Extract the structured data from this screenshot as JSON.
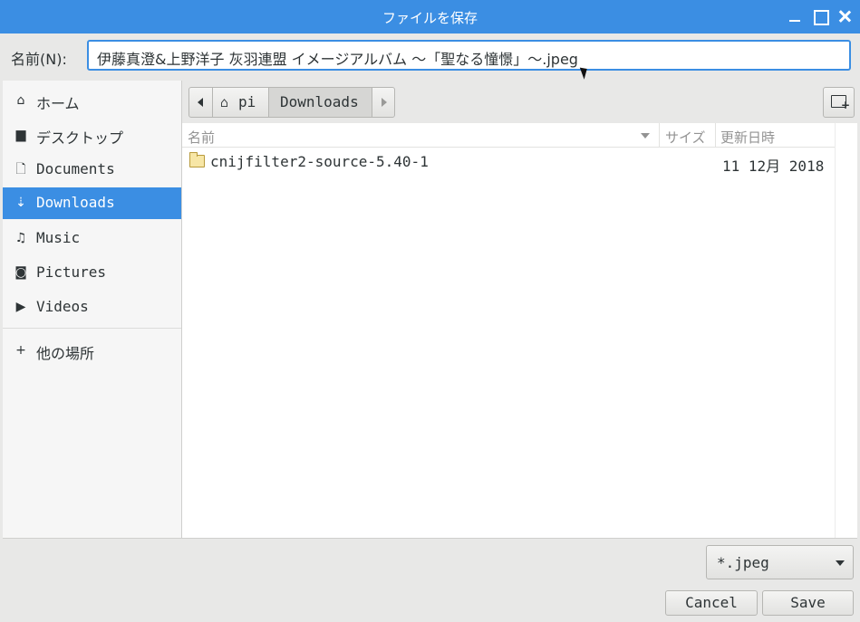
{
  "window": {
    "title": "ファイルを保存"
  },
  "name_bar": {
    "label": "名前(N):",
    "value": "伊藤真澄&上野洋子  灰羽連盟  イメージアルバム  〜「聖なる憧憬」〜.jpeg"
  },
  "sidebar": {
    "items": [
      {
        "label": "ホーム",
        "icon": "home-icon"
      },
      {
        "label": "デスクトップ",
        "icon": "folder-icon"
      },
      {
        "label": "Documents",
        "icon": "document-icon"
      },
      {
        "label": "Downloads",
        "icon": "download-icon",
        "active": true
      },
      {
        "label": "Music",
        "icon": "music-icon"
      },
      {
        "label": "Pictures",
        "icon": "camera-icon"
      },
      {
        "label": "Videos",
        "icon": "video-icon"
      },
      {
        "label": "他の場所",
        "icon": "plus-icon"
      }
    ]
  },
  "path_bar": {
    "home": "pi",
    "current": "Downloads"
  },
  "columns": {
    "name": "名前",
    "size": "サイズ",
    "modified": "更新日時"
  },
  "files": [
    {
      "name": "cnijfilter2-source-5.40-1",
      "type": "folder",
      "modified": "11 12月 2018"
    }
  ],
  "footer": {
    "filter": "*.jpeg",
    "cancel": "Cancel",
    "save": "Save"
  },
  "colors": {
    "accent": "#3b8ee3"
  }
}
